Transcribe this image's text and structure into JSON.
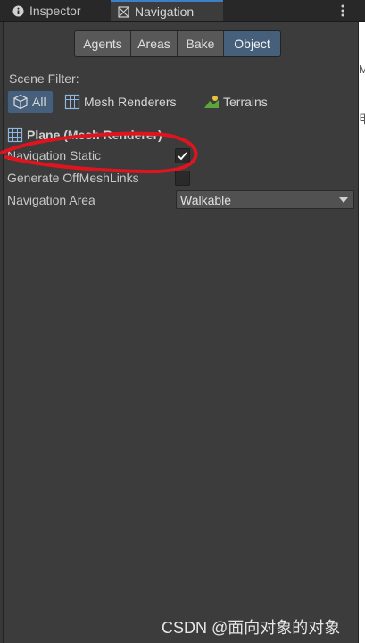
{
  "tabs": {
    "inspector": "Inspector",
    "navigation": "Navigation"
  },
  "modes": [
    {
      "label": "Agents",
      "active": false
    },
    {
      "label": "Areas",
      "active": false
    },
    {
      "label": "Bake",
      "active": false
    },
    {
      "label": "Object",
      "active": true
    }
  ],
  "scene_filter": {
    "label": "Scene Filter:",
    "options": [
      {
        "label": "All",
        "icon": "cube-icon",
        "active": true
      },
      {
        "label": "Mesh Renderers",
        "icon": "mesh-grid-icon",
        "active": false
      },
      {
        "label": "Terrains",
        "icon": "terrain-icon",
        "active": false
      }
    ]
  },
  "object": {
    "title": "Plane (Mesh Renderer)",
    "navigation_static": {
      "label": "Navigation Static",
      "checked": true
    },
    "offmeshlinks": {
      "label": "Generate OffMeshLinks",
      "checked": false
    },
    "area": {
      "label": "Navigation Area",
      "value": "Walkable"
    }
  },
  "side_fragments": [
    "M",
    "甲"
  ],
  "watermark": "CSDN @面向对象的对象",
  "colors": {
    "background": "#383838",
    "tab_bar": "#282828",
    "active_blue": "#46607c",
    "annotation_red": "#e0141e"
  }
}
